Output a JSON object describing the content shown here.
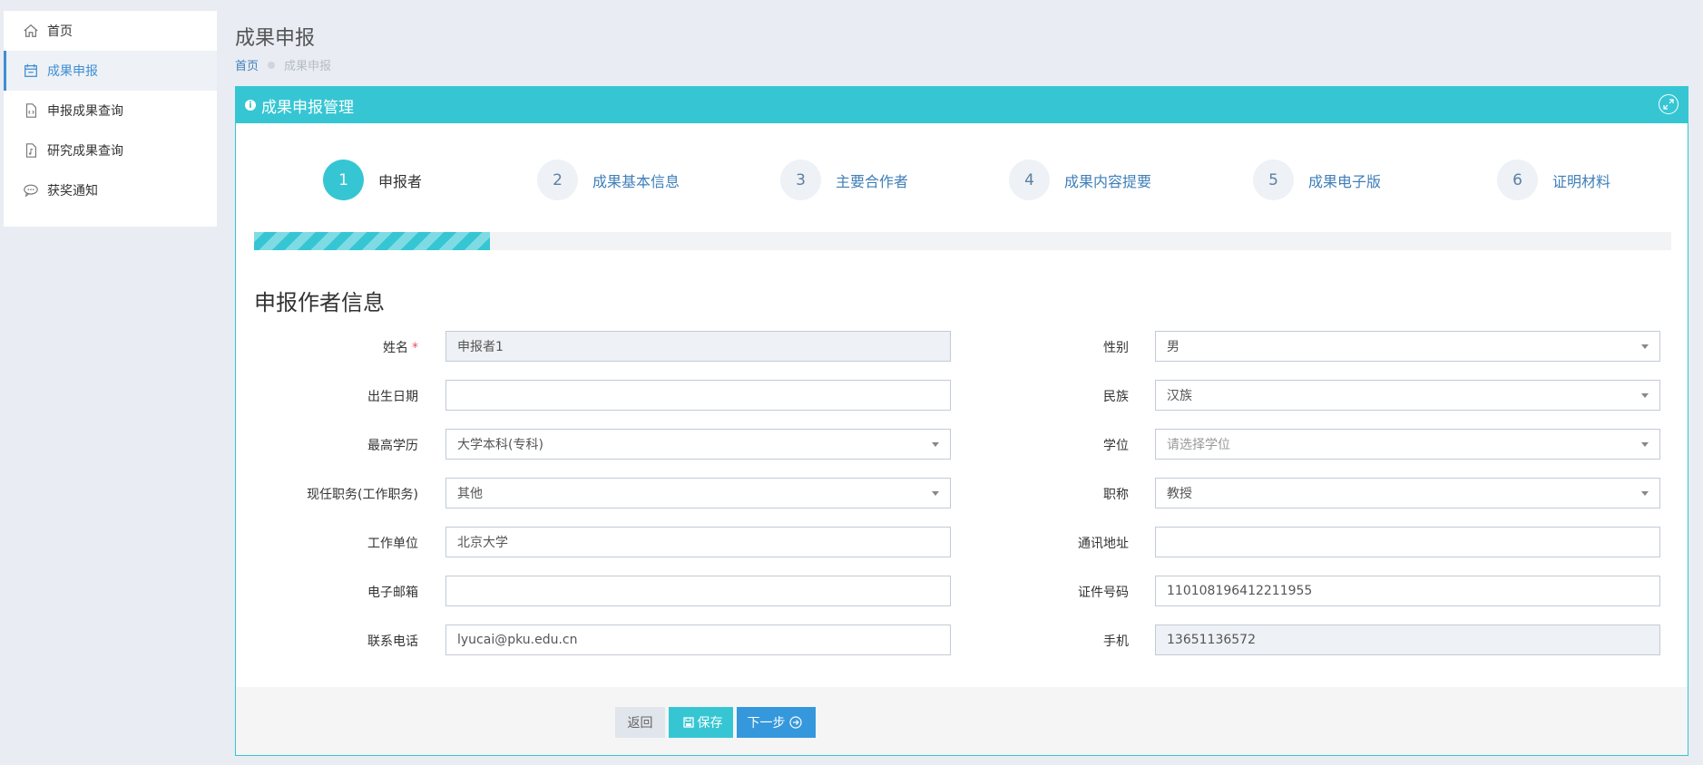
{
  "sidebar": {
    "items": [
      {
        "label": "首页",
        "icon": "home-icon",
        "active": false
      },
      {
        "label": "成果申报",
        "icon": "calendar-icon",
        "active": true
      },
      {
        "label": "申报成果查询",
        "icon": "code-file-icon",
        "active": false
      },
      {
        "label": "研究成果查询",
        "icon": "music-file-icon",
        "active": false
      },
      {
        "label": "获奖通知",
        "icon": "comment-icon",
        "active": false
      }
    ]
  },
  "header": {
    "title": "成果申报",
    "breadcrumb": [
      "首页",
      "成果申报"
    ]
  },
  "panel": {
    "title": "成果申报管理"
  },
  "steps": [
    {
      "num": "1",
      "label": "申报者"
    },
    {
      "num": "2",
      "label": "成果基本信息"
    },
    {
      "num": "3",
      "label": "主要合作者"
    },
    {
      "num": "4",
      "label": "成果内容提要"
    },
    {
      "num": "5",
      "label": "成果电子版"
    },
    {
      "num": "6",
      "label": "证明材料"
    }
  ],
  "progress": {
    "fraction": 0.1667
  },
  "section": {
    "title": "申报作者信息"
  },
  "form": {
    "left": [
      {
        "label": "姓名",
        "required": true,
        "value": "申报者1",
        "type": "text",
        "disabled": true
      },
      {
        "label": "出生日期",
        "value": "",
        "type": "text"
      },
      {
        "label": "最高学历",
        "value": "大学本科(专科)",
        "type": "select"
      },
      {
        "label": "现任职务(工作职务)",
        "value": "其他",
        "type": "select"
      },
      {
        "label": "工作单位",
        "value": "北京大学",
        "type": "text"
      },
      {
        "label": "电子邮箱",
        "value": "",
        "type": "text"
      },
      {
        "label": "联系电话",
        "value": "lyucai@pku.edu.cn",
        "type": "text"
      }
    ],
    "right": [
      {
        "label": "性别",
        "value": "男",
        "type": "select"
      },
      {
        "label": "民族",
        "value": "汉族",
        "type": "select"
      },
      {
        "label": "学位",
        "value": "请选择学位",
        "type": "select",
        "placeholder": true
      },
      {
        "label": "职称",
        "value": "教授",
        "type": "select"
      },
      {
        "label": "通讯地址",
        "value": "",
        "type": "text"
      },
      {
        "label": "证件号码",
        "value": "110108196412211955",
        "type": "text"
      },
      {
        "label": "手机",
        "value": "13651136572",
        "type": "text",
        "disabled": true
      }
    ]
  },
  "buttons": {
    "back": "返回",
    "save": "保存",
    "next": "下一步"
  },
  "colors": {
    "accent": "#36c6d3",
    "primary": "#3598dc",
    "link": "#3f7fb8"
  }
}
